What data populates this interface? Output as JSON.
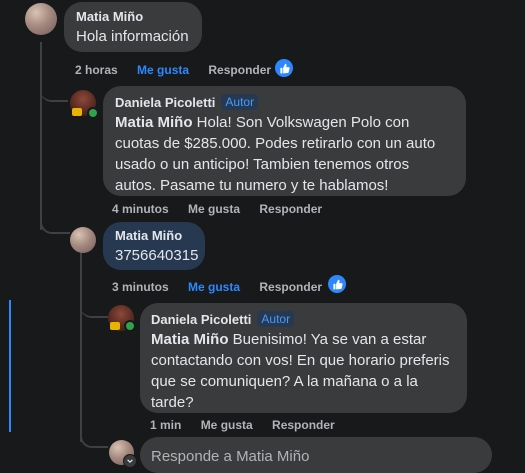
{
  "comment1": {
    "author": "Matia Miño",
    "text": "Hola información",
    "time": "2 horas",
    "like": "Me gusta",
    "reply": "Responder"
  },
  "reply1": {
    "author": "Daniela Picoletti",
    "badge": "Autor",
    "mention": "Matia Miño",
    "text": " Hola! Son Volkswagen Polo con cuotas de $285.000. Podes retirarlo con un auto usado o un anticipo! Tambien tenemos otros autos. Pasame tu numero y te hablamos!",
    "time": "4 minutos",
    "like": "Me gusta",
    "reply": "Responder"
  },
  "reply2": {
    "author": "Matia Miño",
    "text": "3756640315",
    "time": "3 minutos",
    "like": "Me gusta",
    "reply": "Responder"
  },
  "reply3": {
    "author": "Daniela Picoletti",
    "badge": "Autor",
    "mention": "Matia Miño",
    "text": " Buenisimo! Ya se van a estar contactando con vos! En que horario preferis que se comuniquen? A la mañana o a la tarde?",
    "time": "1 min",
    "like": "Me gusta",
    "reply": "Responder"
  },
  "composer": {
    "placeholder": "Responde a Matia Miño"
  },
  "colors": {
    "background": "#18191a",
    "bubble": "#3a3b3c",
    "highlight_bubble": "#263951",
    "accent": "#2d88ff"
  }
}
